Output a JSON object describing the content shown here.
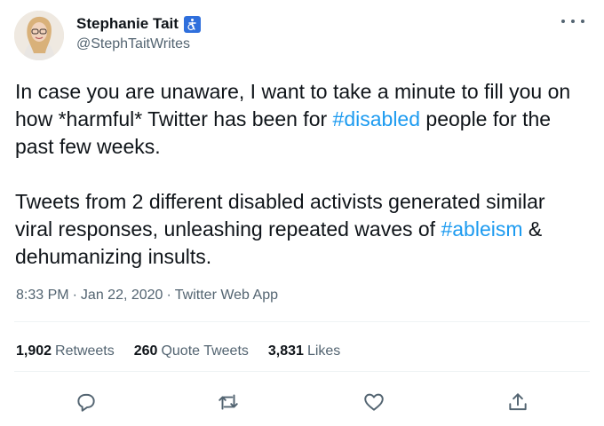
{
  "author": {
    "display_name": "Stephanie Tait",
    "handle": "@StephTaitWrites",
    "badge_icon": "accessibility-icon",
    "badge_color": "#2f6fdc"
  },
  "tweet": {
    "para1_a": "In case you are unaware, I want to take a minute to fill you on how *harmful* Twitter has been for ",
    "hashtag1": "#disabled",
    "para1_b": " people for the past few weeks.",
    "para2_a": "Tweets from 2 different disabled activists generated similar viral responses, unleashing repeated waves of ",
    "hashtag2": "#ableism",
    "para2_b": " & dehumanizing insults."
  },
  "meta": {
    "time": "8:33 PM",
    "separator": "·",
    "date": "Jan 22, 2020",
    "source": "Twitter Web App"
  },
  "stats": {
    "retweets_count": "1,902",
    "retweets_label": "Retweets",
    "quotes_count": "260",
    "quotes_label": "Quote Tweets",
    "likes_count": "3,831",
    "likes_label": "Likes"
  },
  "actions": [
    "reply-icon",
    "retweet-icon",
    "like-icon",
    "share-icon"
  ],
  "colors": {
    "text": "#0f1419",
    "secondary": "#536471",
    "link": "#1d9bf0",
    "divider": "#eff3f4"
  }
}
